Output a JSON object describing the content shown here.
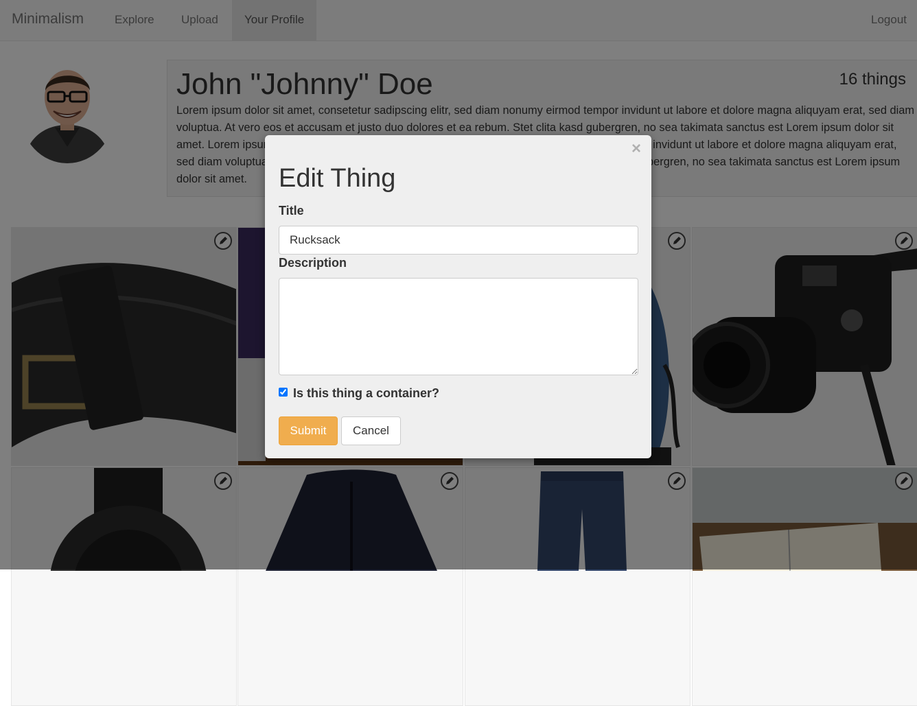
{
  "navbar": {
    "brand": "Minimalism",
    "links": [
      "Explore",
      "Upload",
      "Your Profile"
    ],
    "logout": "Logout"
  },
  "profile": {
    "name": "John \"Johnny\" Doe",
    "things_count": "16 things",
    "bio": "Lorem ipsum dolor sit amet, consetetur sadipscing elitr, sed diam nonumy eirmod tempor invidunt ut labore et dolore magna aliquyam erat, sed diam voluptua. At vero eos et accusam et justo duo dolores et ea rebum. Stet clita kasd gubergren, no sea takimata sanctus est Lorem ipsum dolor sit amet. Lorem ipsum dolor sit amet, consetetur sadipscing elitr, sed diam nonumy eirmod tempor invidunt ut labore et dolore magna aliquyam erat, sed diam voluptua. At vero eos et accusam et justo duo dolores et ea rebum. Stet clita kasd gubergren, no sea takimata sanctus est Lorem ipsum dolor sit amet."
  },
  "things": [
    {
      "item": "belt"
    },
    {
      "item": "laptop"
    },
    {
      "item": "rucksack"
    },
    {
      "item": "camera"
    },
    {
      "item": "watch"
    },
    {
      "item": "jacket"
    },
    {
      "item": "jeans"
    },
    {
      "item": "notebook"
    }
  ],
  "modal": {
    "title": "Edit Thing",
    "close_glyph": "×",
    "title_label": "Title",
    "title_value": "Rucksack",
    "description_label": "Description",
    "description_value": "",
    "container_label": "Is this thing a container?",
    "container_checked": true,
    "submit": "Submit",
    "cancel": "Cancel"
  },
  "colors": {
    "accent": "#f0ad4e",
    "overlay": "rgba(0,0,0,0.5)"
  }
}
